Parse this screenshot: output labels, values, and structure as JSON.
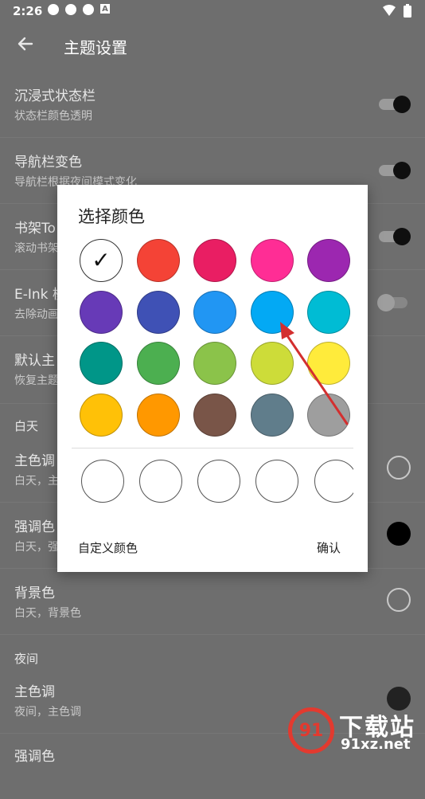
{
  "status_bar": {
    "time": "2:26",
    "left_icons": [
      "app-notification-icon",
      "app-notification-icon",
      "app-notification-icon",
      "a-icon"
    ],
    "a_icon_label": "A",
    "right_icons": [
      "wifi-icon",
      "battery-icon"
    ]
  },
  "header": {
    "title": "主题设置",
    "back_icon": "back-arrow-icon"
  },
  "settings": {
    "immersive_title": "沉浸式状态栏",
    "immersive_sub": "状态栏颜色透明",
    "navbar_title": "导航栏变色",
    "navbar_sub": "导航栏根据夜间模式变化",
    "bookshelf_title": "书架To",
    "bookshelf_sub": "滚动书架",
    "eink_title": "E-Ink 模",
    "eink_sub": "去除动画",
    "default_title": "默认主",
    "default_sub": "恢复主题",
    "day_header": "白天",
    "day_primary_title": "主色调",
    "day_primary_sub": "白天，主",
    "day_accent_title": "强调色",
    "day_accent_sub": "白天，强",
    "day_bg_title": "背景色",
    "day_bg_sub": "白天，背景色",
    "night_header": "夜间",
    "night_primary_title": "主色调",
    "night_primary_sub": "夜间，主色调",
    "night_accent_title": "强调色"
  },
  "dialog": {
    "title": "选择颜色",
    "check_glyph": "✓",
    "custom_color_label": "自定义颜色",
    "confirm_label": "确认",
    "selected_color": "#ffffff",
    "palette": [
      "#ffffff",
      "#f44336",
      "#e91e63",
      "#ff2d95",
      "#9c27b0",
      "#673ab7",
      "#3f51b5",
      "#2196f3",
      "#03a9f4",
      "#00bcd4",
      "#009688",
      "#4caf50",
      "#8bc34a",
      "#cddc39",
      "#ffeb3b",
      "#ffc107",
      "#ff9800",
      "#795548",
      "#607d8b",
      "#9e9e9e"
    ]
  },
  "colors": {
    "accent_arrow": "#d32f2f",
    "overlay_bg": "#6e6e6e",
    "dialog_bg": "#ffffff"
  },
  "watermark": {
    "logo_text": "91",
    "text": "下载站",
    "url": "91xz.net"
  }
}
